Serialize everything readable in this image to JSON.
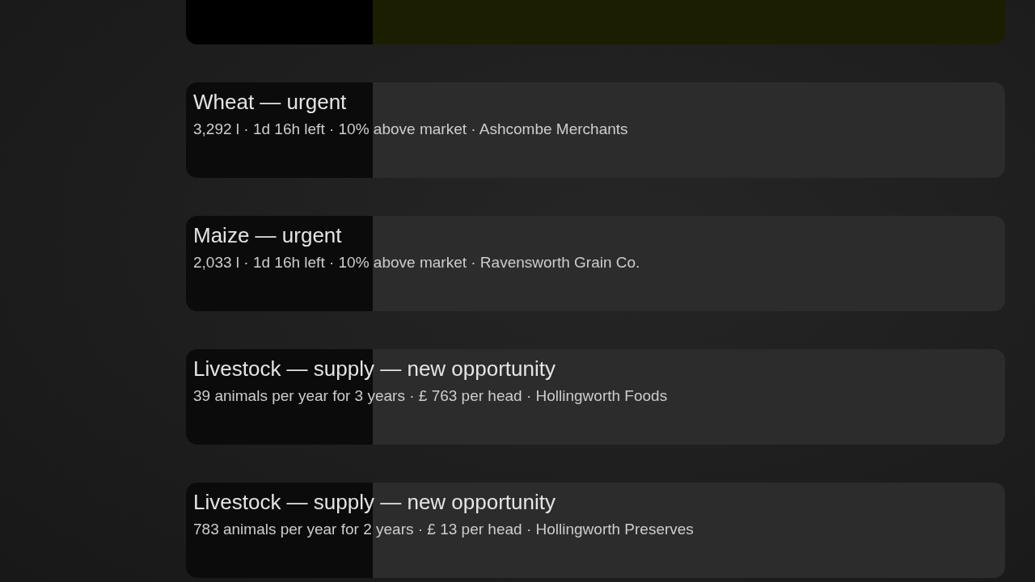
{
  "offers": [
    {
      "selected": true
    },
    {
      "title": "Wheat — urgent",
      "details": "3,292 l · 1d 16h left · 10% above market · Ashcombe Merchants",
      "selected": false
    },
    {
      "title": "Maize — urgent",
      "details": "2,033 l · 1d 16h left · 10% above market · Ravensworth Grain Co.",
      "selected": false
    },
    {
      "title": "Livestock — supply — new opportunity",
      "details": "39 animals per year for 3 years · £ 763 per head · Hollingworth Foods",
      "selected": false
    },
    {
      "title": "Livestock — supply — new opportunity",
      "details": "783 animals per year for 2 years · £ 13 per head · Hollingworth Preserves",
      "selected": false
    }
  ]
}
